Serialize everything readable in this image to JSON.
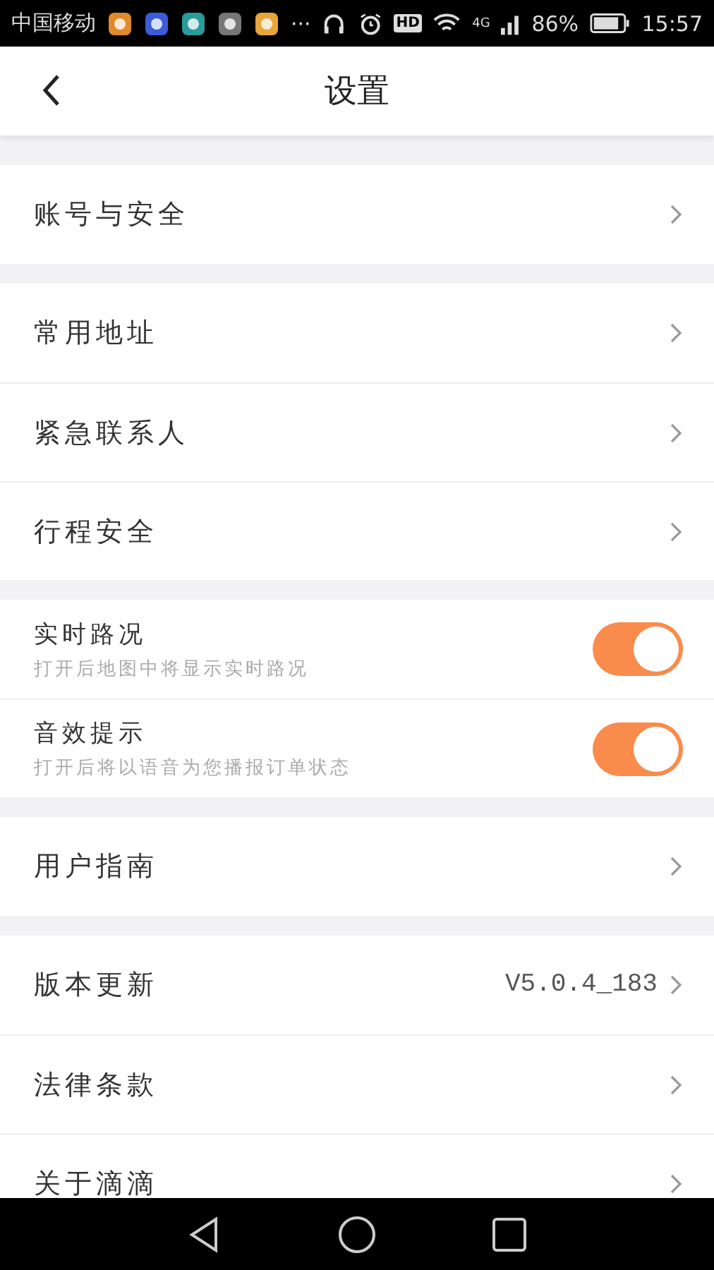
{
  "status_bar": {
    "carrier": "中国移动",
    "more": "···",
    "hd": "HD",
    "network": "4G",
    "battery": "86%",
    "time": "15:57"
  },
  "header": {
    "title": "设置"
  },
  "groups": [
    {
      "items": [
        {
          "kind": "link",
          "label": "账号与安全"
        }
      ]
    },
    {
      "items": [
        {
          "kind": "link",
          "label": "常用地址"
        },
        {
          "kind": "link",
          "label": "紧急联系人"
        },
        {
          "kind": "link",
          "label": "行程安全"
        }
      ]
    },
    {
      "items": [
        {
          "kind": "toggle",
          "label": "实时路况",
          "description": "打开后地图中将显示实时路况",
          "on": true
        },
        {
          "kind": "toggle",
          "label": "音效提示",
          "description": "打开后将以语音为您播报订单状态",
          "on": true
        }
      ]
    },
    {
      "items": [
        {
          "kind": "link",
          "label": "用户指南"
        }
      ]
    },
    {
      "items": [
        {
          "kind": "link",
          "label": "版本更新",
          "value": "V5.0.4_183"
        },
        {
          "kind": "link",
          "label": "法律条款"
        },
        {
          "kind": "link",
          "label": "关于滴滴"
        }
      ]
    }
  ]
}
